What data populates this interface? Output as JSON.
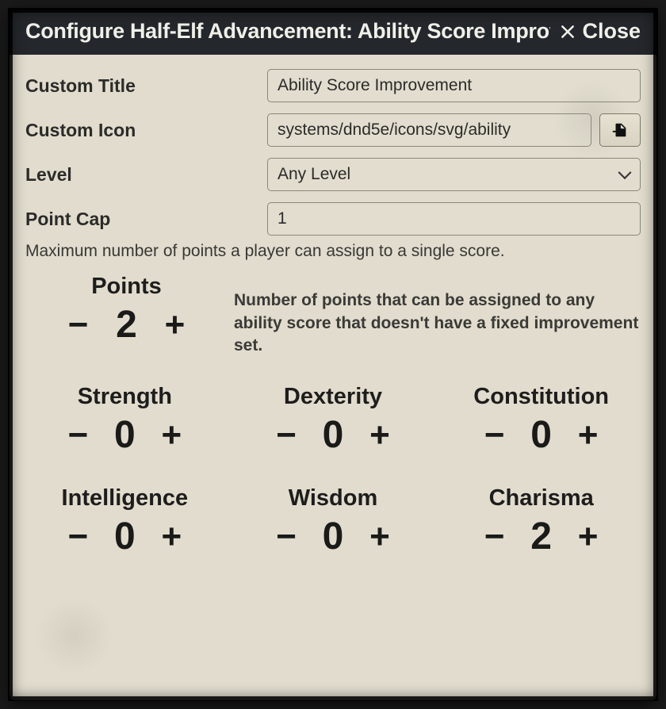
{
  "window": {
    "title": "Configure Half-Elf Advancement: Ability Score Improve",
    "close_label": "Close"
  },
  "form": {
    "custom_title": {
      "label": "Custom Title",
      "value": "Ability Score Improvement"
    },
    "custom_icon": {
      "label": "Custom Icon",
      "value": "systems/dnd5e/icons/svg/ability"
    },
    "level": {
      "label": "Level",
      "selected": "Any Level"
    },
    "point_cap": {
      "label": "Point Cap",
      "value": "1",
      "hint": "Maximum number of points a player can assign to a single score."
    }
  },
  "points": {
    "label": "Points",
    "value": "2",
    "description": "Number of points that can be assigned to any ability score that doesn't have a fixed improvement set."
  },
  "abilities": [
    {
      "label": "Strength",
      "value": "0"
    },
    {
      "label": "Dexterity",
      "value": "0"
    },
    {
      "label": "Constitution",
      "value": "0"
    },
    {
      "label": "Intelligence",
      "value": "0"
    },
    {
      "label": "Wisdom",
      "value": "0"
    },
    {
      "label": "Charisma",
      "value": "2"
    }
  ]
}
